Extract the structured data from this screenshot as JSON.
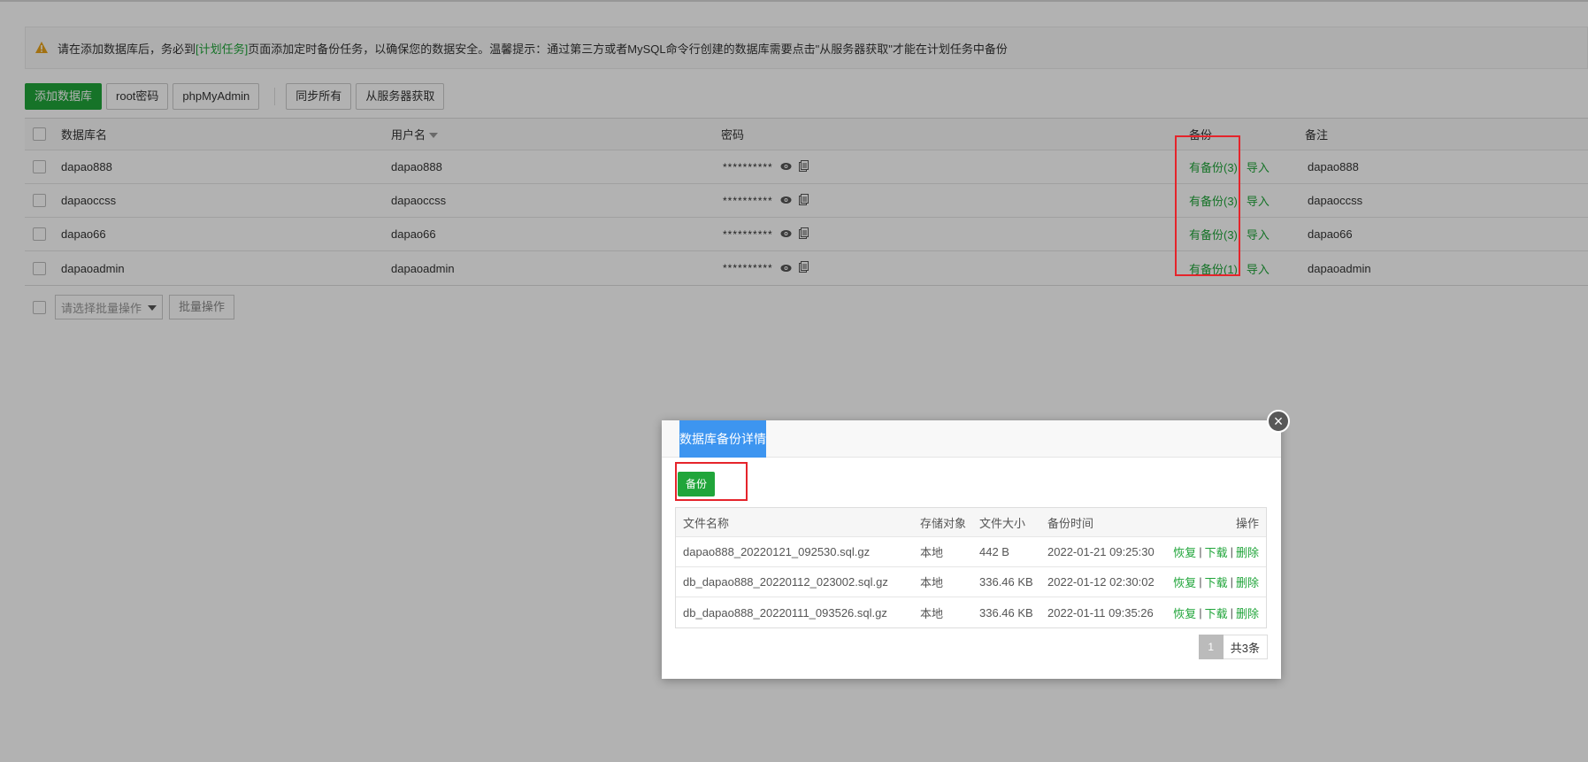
{
  "alert": {
    "text_before": "请在添加数据库后，务必到",
    "link_text": "[计划任务]",
    "text_after": "页面添加定时备份任务，以确保您的数据安全。温馨提示：通过第三方或者MySQL命令行创建的数据库需要点击\"从服务器获取\"才能在计划任务中备份"
  },
  "toolbar": {
    "add_db": "添加数据库",
    "root_pw": "root密码",
    "phpmyadmin": "phpMyAdmin",
    "sync_all": "同步所有",
    "from_server": "从服务器获取"
  },
  "db_table": {
    "headers": {
      "name": "数据库名",
      "user": "用户名",
      "password": "密码",
      "backup": "备份",
      "note": "备注"
    },
    "rows": [
      {
        "name": "dapao888",
        "user": "dapao888",
        "password": "**********",
        "backup": "有备份(3)",
        "import": "导入",
        "note": "dapao888"
      },
      {
        "name": "dapaoccss",
        "user": "dapaoccss",
        "password": "**********",
        "backup": "有备份(3)",
        "import": "导入",
        "note": "dapaoccss"
      },
      {
        "name": "dapao66",
        "user": "dapao66",
        "password": "**********",
        "backup": "有备份(3)",
        "import": "导入",
        "note": "dapao66"
      },
      {
        "name": "dapaoadmin",
        "user": "dapaoadmin",
        "password": "**********",
        "backup": "有备份(1)",
        "import": "导入",
        "note": "dapaoadmin"
      }
    ]
  },
  "bulk": {
    "select_placeholder": "请选择批量操作",
    "button": "批量操作"
  },
  "modal": {
    "title": "数据库备份详情",
    "close_glyph": "×",
    "backup_button": "备份",
    "headers": {
      "file": "文件名称",
      "storage": "存储对象",
      "size": "文件大小",
      "time": "备份时间",
      "ops": "操作"
    },
    "rows": [
      {
        "file": "dapao888_20220121_092530.sql.gz",
        "storage": "本地",
        "size": "442 B",
        "time": "2022-01-21 09:25:30",
        "restore": "恢复",
        "download": "下载",
        "delete": "删除"
      },
      {
        "file": "db_dapao888_20220112_023002.sql.gz",
        "storage": "本地",
        "size": "336.46 KB",
        "time": "2022-01-12 02:30:02",
        "restore": "恢复",
        "download": "下载",
        "delete": "删除"
      },
      {
        "file": "db_dapao888_20220111_093526.sql.gz",
        "storage": "本地",
        "size": "336.46 KB",
        "time": "2022-01-11 09:35:26",
        "restore": "恢复",
        "download": "下载",
        "delete": "删除"
      }
    ],
    "ops_sep": "|",
    "pager": {
      "current": "1",
      "total": "共3条"
    }
  },
  "colors": {
    "accent_green": "#20a53a",
    "title_blue": "#3d95f0",
    "highlight_red": "#e5242b"
  }
}
